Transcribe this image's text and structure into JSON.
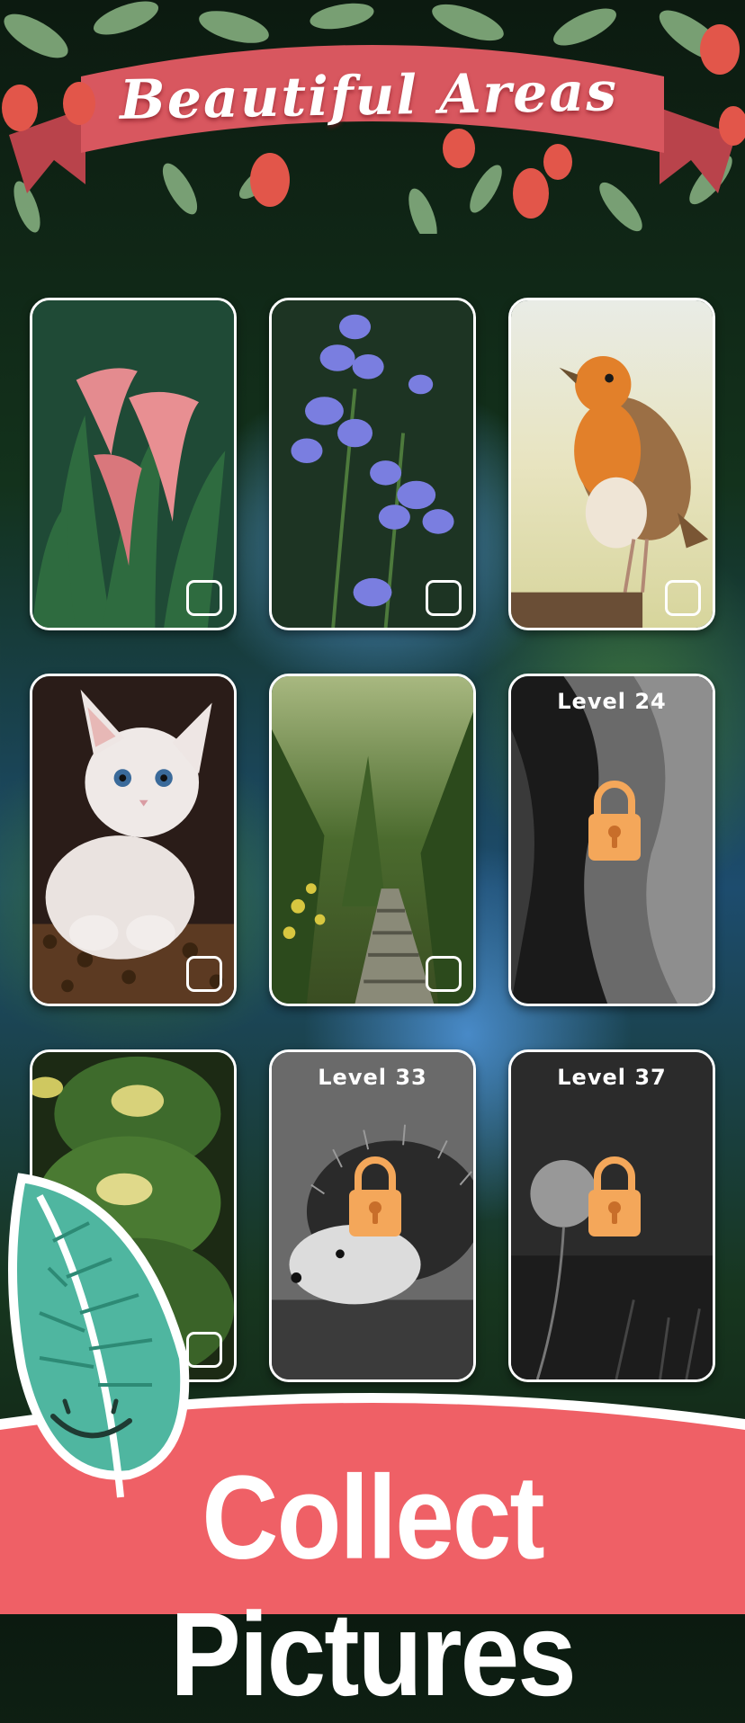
{
  "header": {
    "title": "Beautiful Areas"
  },
  "pictures": [
    {
      "subject": "calla lilies",
      "locked": false,
      "level": ""
    },
    {
      "subject": "bluebells",
      "locked": false,
      "level": ""
    },
    {
      "subject": "robin",
      "locked": false,
      "level": ""
    },
    {
      "subject": "white kitten",
      "locked": false,
      "level": ""
    },
    {
      "subject": "forest path",
      "locked": false,
      "level": ""
    },
    {
      "subject": "canyon",
      "locked": true,
      "level": "Level 24"
    },
    {
      "subject": "cactus",
      "locked": false,
      "level": ""
    },
    {
      "subject": "hedgehog",
      "locked": true,
      "level": "Level 33"
    },
    {
      "subject": "dandelion",
      "locked": true,
      "level": "Level 37"
    }
  ],
  "footer": {
    "title": "Collect Pictures"
  },
  "icons": {
    "lock": "padlock-icon",
    "checkbox": "checkbox-icon",
    "mascot": "smiling-leaf-icon"
  },
  "colors": {
    "banner": "#d8575f",
    "footer_band": "#ef6066",
    "lock": "#f4a75a",
    "mascot": "#4fb6a0"
  }
}
